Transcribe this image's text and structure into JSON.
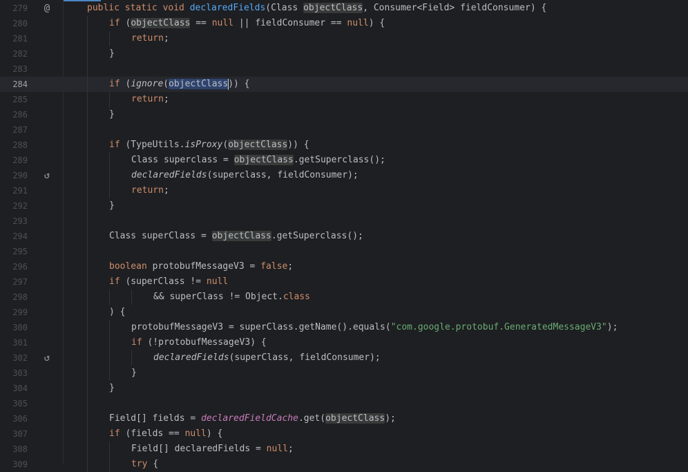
{
  "editor": {
    "colors": {
      "background": "#1e1f22",
      "current_line": "#26282e",
      "keyword": "#cf8e6d",
      "function_decl": "#56a8f5",
      "static_field": "#c77dbb",
      "string": "#6aab73",
      "identifier_highlight": "#373b39",
      "selected_identifier": "#2e436e"
    },
    "lines": [
      {
        "num": "279",
        "icon": "@",
        "indent": 1,
        "tokens": [
          {
            "t": "public static void ",
            "c": "kw"
          },
          {
            "t": "declaredFields",
            "c": "fn"
          },
          {
            "t": "(Class ",
            "c": "plain"
          },
          {
            "t": "objectClass",
            "c": "hl"
          },
          {
            "t": ", Consumer<Field> fieldConsumer) {",
            "c": "plain"
          }
        ]
      },
      {
        "num": "280",
        "indent": 2,
        "tokens": [
          {
            "t": "if ",
            "c": "kw"
          },
          {
            "t": "(",
            "c": "plain"
          },
          {
            "t": "objectClass",
            "c": "hl"
          },
          {
            "t": " == ",
            "c": "plain"
          },
          {
            "t": "null",
            "c": "kw"
          },
          {
            "t": " || fieldConsumer == ",
            "c": "plain"
          },
          {
            "t": "null",
            "c": "kw"
          },
          {
            "t": ") {",
            "c": "plain"
          }
        ]
      },
      {
        "num": "281",
        "indent": 3,
        "tokens": [
          {
            "t": "return",
            "c": "kw"
          },
          {
            "t": ";",
            "c": "plain"
          }
        ]
      },
      {
        "num": "282",
        "indent": 2,
        "tokens": [
          {
            "t": "}",
            "c": "plain"
          }
        ]
      },
      {
        "num": "283",
        "indent": 0,
        "tokens": []
      },
      {
        "num": "284",
        "indent": 2,
        "current": true,
        "tokens": [
          {
            "t": "if ",
            "c": "kw"
          },
          {
            "t": "(",
            "c": "plain"
          },
          {
            "t": "ignore",
            "c": "it"
          },
          {
            "t": "(",
            "c": "plain"
          },
          {
            "t": "objectClass",
            "c": "cur",
            "caret": true
          },
          {
            "t": ")) {",
            "c": "plain"
          }
        ]
      },
      {
        "num": "285",
        "indent": 3,
        "tokens": [
          {
            "t": "return",
            "c": "kw"
          },
          {
            "t": ";",
            "c": "plain"
          }
        ]
      },
      {
        "num": "286",
        "indent": 2,
        "tokens": [
          {
            "t": "}",
            "c": "plain"
          }
        ]
      },
      {
        "num": "287",
        "indent": 0,
        "tokens": []
      },
      {
        "num": "288",
        "indent": 2,
        "tokens": [
          {
            "t": "if ",
            "c": "kw"
          },
          {
            "t": "(TypeUtils.",
            "c": "plain"
          },
          {
            "t": "isProxy",
            "c": "it"
          },
          {
            "t": "(",
            "c": "plain"
          },
          {
            "t": "objectClass",
            "c": "hl"
          },
          {
            "t": ")) {",
            "c": "plain"
          }
        ]
      },
      {
        "num": "289",
        "indent": 3,
        "tokens": [
          {
            "t": "Class superclass = ",
            "c": "plain"
          },
          {
            "t": "objectClass",
            "c": "hl"
          },
          {
            "t": ".getSuperclass();",
            "c": "plain"
          }
        ]
      },
      {
        "num": "290",
        "icon": "↺",
        "indent": 3,
        "tokens": [
          {
            "t": "declaredFields",
            "c": "it"
          },
          {
            "t": "(superclass, fieldConsumer);",
            "c": "plain"
          }
        ]
      },
      {
        "num": "291",
        "indent": 3,
        "tokens": [
          {
            "t": "return",
            "c": "kw"
          },
          {
            "t": ";",
            "c": "plain"
          }
        ]
      },
      {
        "num": "292",
        "indent": 2,
        "tokens": [
          {
            "t": "}",
            "c": "plain"
          }
        ]
      },
      {
        "num": "293",
        "indent": 0,
        "tokens": []
      },
      {
        "num": "294",
        "indent": 2,
        "tokens": [
          {
            "t": "Class superClass = ",
            "c": "plain"
          },
          {
            "t": "objectClass",
            "c": "hl"
          },
          {
            "t": ".getSuperclass();",
            "c": "plain"
          }
        ]
      },
      {
        "num": "295",
        "indent": 0,
        "tokens": []
      },
      {
        "num": "296",
        "indent": 2,
        "tokens": [
          {
            "t": "boolean ",
            "c": "kw"
          },
          {
            "t": "protobufMessageV3 = ",
            "c": "plain"
          },
          {
            "t": "false",
            "c": "kw"
          },
          {
            "t": ";",
            "c": "plain"
          }
        ]
      },
      {
        "num": "297",
        "indent": 2,
        "tokens": [
          {
            "t": "if ",
            "c": "kw"
          },
          {
            "t": "(superClass != ",
            "c": "plain"
          },
          {
            "t": "null",
            "c": "kw"
          }
        ]
      },
      {
        "num": "298",
        "indent": 4,
        "tokens": [
          {
            "t": "&& superClass != Object.",
            "c": "plain"
          },
          {
            "t": "class",
            "c": "kw"
          }
        ]
      },
      {
        "num": "299",
        "indent": 2,
        "tokens": [
          {
            "t": ") {",
            "c": "plain"
          }
        ]
      },
      {
        "num": "300",
        "indent": 3,
        "tokens": [
          {
            "t": "protobufMessageV3 = superClass.getName().equals(",
            "c": "plain"
          },
          {
            "t": "\"com.google.protobuf.GeneratedMessageV3\"",
            "c": "str"
          },
          {
            "t": ");",
            "c": "plain"
          }
        ]
      },
      {
        "num": "301",
        "indent": 3,
        "tokens": [
          {
            "t": "if ",
            "c": "kw"
          },
          {
            "t": "(!protobufMessageV3) {",
            "c": "plain"
          }
        ]
      },
      {
        "num": "302",
        "icon": "↺",
        "indent": 4,
        "tokens": [
          {
            "t": "declaredFields",
            "c": "it"
          },
          {
            "t": "(superClass, fieldConsumer);",
            "c": "plain"
          }
        ]
      },
      {
        "num": "303",
        "indent": 3,
        "tokens": [
          {
            "t": "}",
            "c": "plain"
          }
        ]
      },
      {
        "num": "304",
        "indent": 2,
        "tokens": [
          {
            "t": "}",
            "c": "plain"
          }
        ]
      },
      {
        "num": "305",
        "indent": 0,
        "tokens": []
      },
      {
        "num": "306",
        "indent": 2,
        "tokens": [
          {
            "t": "Field[] fields = ",
            "c": "plain"
          },
          {
            "t": "declaredFieldCache",
            "c": "static"
          },
          {
            "t": ".get(",
            "c": "plain"
          },
          {
            "t": "objectClass",
            "c": "hl"
          },
          {
            "t": ");",
            "c": "plain"
          }
        ]
      },
      {
        "num": "307",
        "indent": 2,
        "tokens": [
          {
            "t": "if ",
            "c": "kw"
          },
          {
            "t": "(fields == ",
            "c": "plain"
          },
          {
            "t": "null",
            "c": "kw"
          },
          {
            "t": ") {",
            "c": "plain"
          }
        ]
      },
      {
        "num": "308",
        "indent": 3,
        "tokens": [
          {
            "t": "Field[] declaredFields = ",
            "c": "plain"
          },
          {
            "t": "null",
            "c": "kw"
          },
          {
            "t": ";",
            "c": "plain"
          }
        ]
      },
      {
        "num": "309",
        "indent": 3,
        "tokens": [
          {
            "t": "try ",
            "c": "kw"
          },
          {
            "t": "{",
            "c": "plain"
          }
        ]
      }
    ]
  }
}
